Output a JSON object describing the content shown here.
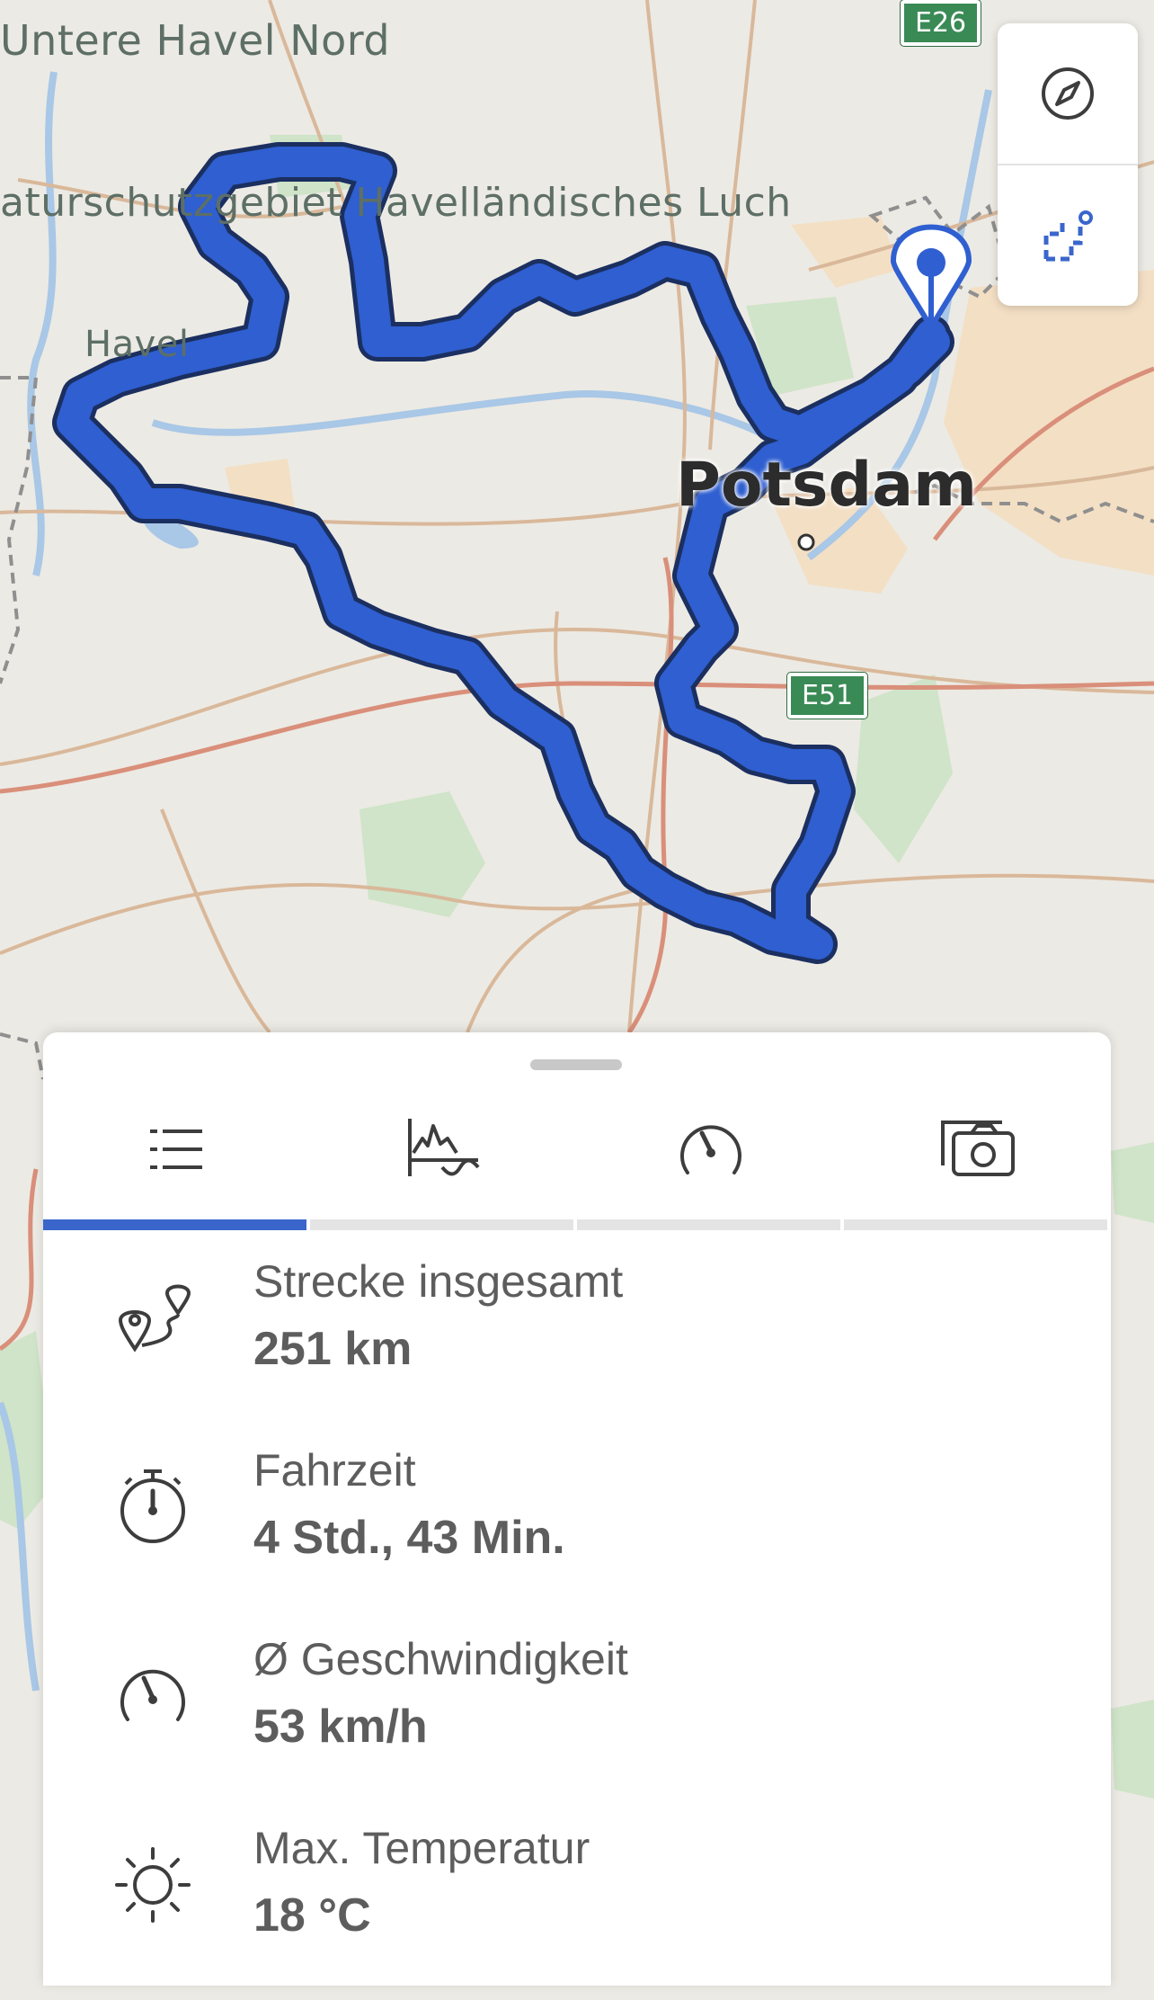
{
  "map": {
    "labels": {
      "untere_havel": "Untere Havel Nord",
      "luch": "aturschutzgebiet Havelländisches Luch",
      "havel": "Havel",
      "city": "Potsdam"
    },
    "shields": {
      "e26": "E26",
      "e51": "E51"
    },
    "route_color": "#2f5fd0"
  },
  "controls": {
    "compass": "compass-icon",
    "route_edit": "route-edit-icon"
  },
  "tabs": [
    {
      "name": "list",
      "icon": "list-icon",
      "active": true
    },
    {
      "name": "elevation",
      "icon": "elevation-icon",
      "active": false
    },
    {
      "name": "speed",
      "icon": "speedometer-icon",
      "active": false
    },
    {
      "name": "photos",
      "icon": "camera-icon",
      "active": false
    }
  ],
  "stats": [
    {
      "label": "Strecke insgesamt",
      "value": "251 km",
      "icon": "route-icon"
    },
    {
      "label": "Fahrzeit",
      "value": "4 Std., 43 Min.",
      "icon": "stopwatch-icon"
    },
    {
      "label": "Ø Geschwindigkeit",
      "value": "53 km/h",
      "icon": "speedometer-icon"
    },
    {
      "label": "Max. Temperatur",
      "value": "18 °C",
      "icon": "sun-icon"
    }
  ],
  "colors": {
    "accent": "#3a66cc",
    "text": "#5d5d5d"
  }
}
